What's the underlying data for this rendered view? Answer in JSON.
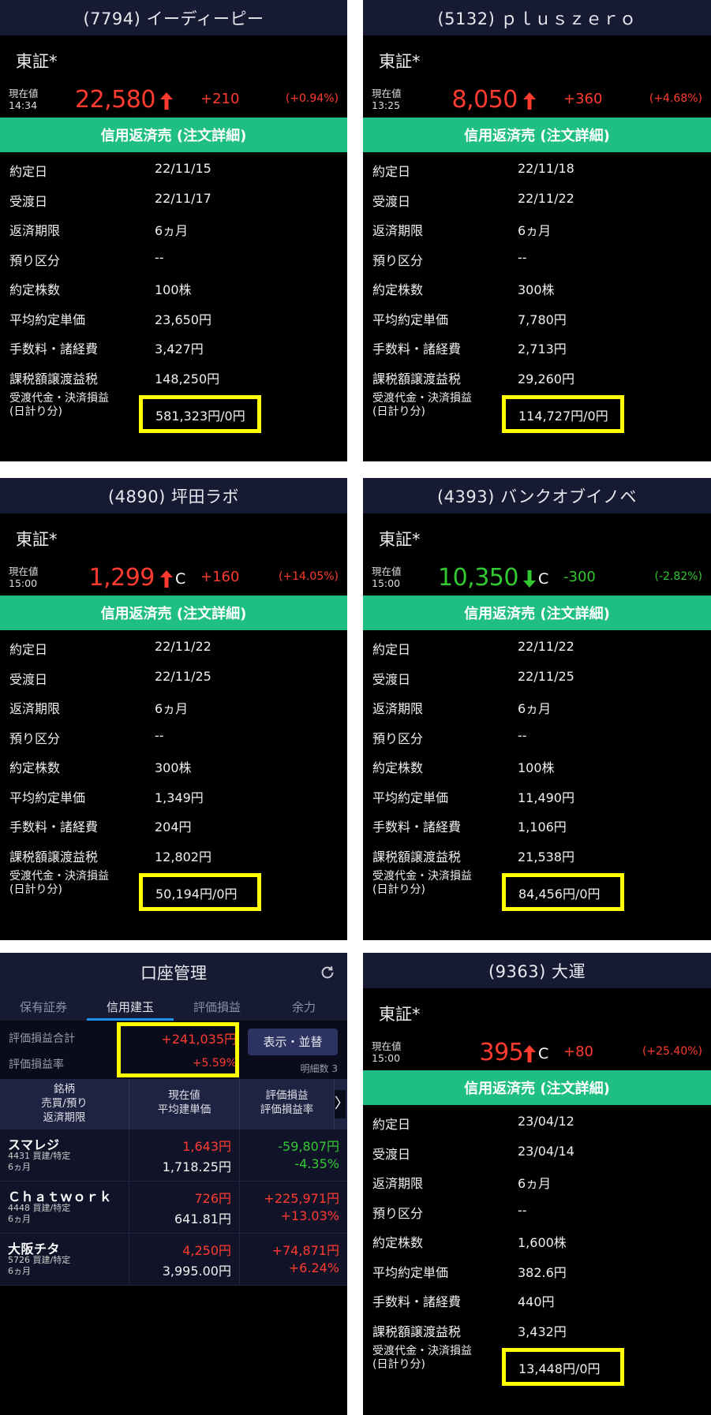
{
  "orders": [
    {
      "title": "(7794) イーディーピー",
      "market": "東証*",
      "price_label_1": "現在値",
      "price_time": "14:34",
      "price": "22,580",
      "direction": "up",
      "c_flag": "",
      "change": "+210",
      "change_pct": "(+0.94%)",
      "section": "信用返済売 (注文詳細)",
      "rows": [
        {
          "k": "約定日",
          "v": "22/11/15"
        },
        {
          "k": "受渡日",
          "v": "22/11/17"
        },
        {
          "k": "返済期限",
          "v": "6ヵ月"
        },
        {
          "k": "預り区分",
          "v": "--"
        },
        {
          "k": "約定株数",
          "v": "100株"
        },
        {
          "k": "平均約定単価",
          "v": "23,650円"
        },
        {
          "k": "手数料・諸経費",
          "v": "3,427円"
        },
        {
          "k": "課税額譲渡益税",
          "v": "148,250円"
        }
      ],
      "settle_label_1": "受渡代金・決済損益",
      "settle_label_2": "(日計り分)",
      "settle_value": "581,323円/0円"
    },
    {
      "title": "(5132) ｐｌｕｓｚｅｒｏ",
      "market": "東証*",
      "price_label_1": "現在値",
      "price_time": "13:25",
      "price": "8,050",
      "direction": "up",
      "c_flag": "",
      "change": "+360",
      "change_pct": "(+4.68%)",
      "section": "信用返済売 (注文詳細)",
      "rows": [
        {
          "k": "約定日",
          "v": "22/11/18"
        },
        {
          "k": "受渡日",
          "v": "22/11/22"
        },
        {
          "k": "返済期限",
          "v": "6ヵ月"
        },
        {
          "k": "預り区分",
          "v": "--"
        },
        {
          "k": "約定株数",
          "v": "300株"
        },
        {
          "k": "平均約定単価",
          "v": "7,780円"
        },
        {
          "k": "手数料・諸経費",
          "v": "2,713円"
        },
        {
          "k": "課税額譲渡益税",
          "v": "29,260円"
        }
      ],
      "settle_label_1": "受渡代金・決済損益",
      "settle_label_2": "(日計り分)",
      "settle_value": "114,727円/0円"
    },
    {
      "title": "(4890) 坪田ラボ",
      "market": "東証*",
      "price_label_1": "現在値",
      "price_time": "15:00",
      "price": "1,299",
      "direction": "up",
      "c_flag": "C",
      "change": "+160",
      "change_pct": "(+14.05%)",
      "section": "信用返済売 (注文詳細)",
      "rows": [
        {
          "k": "約定日",
          "v": "22/11/22"
        },
        {
          "k": "受渡日",
          "v": "22/11/25"
        },
        {
          "k": "返済期限",
          "v": "6ヵ月"
        },
        {
          "k": "預り区分",
          "v": "--"
        },
        {
          "k": "約定株数",
          "v": "300株"
        },
        {
          "k": "平均約定単価",
          "v": "1,349円"
        },
        {
          "k": "手数料・諸経費",
          "v": "204円"
        },
        {
          "k": "課税額譲渡益税",
          "v": "12,802円"
        }
      ],
      "settle_label_1": "受渡代金・決済損益",
      "settle_label_2": "(日計り分)",
      "settle_value": "50,194円/0円"
    },
    {
      "title": "(4393) バンクオブイノベ",
      "market": "東証*",
      "price_label_1": "現在値",
      "price_time": "15:00",
      "price": "10,350",
      "direction": "down",
      "c_flag": "C",
      "change": "-300",
      "change_pct": "(-2.82%)",
      "section": "信用返済売 (注文詳細)",
      "rows": [
        {
          "k": "約定日",
          "v": "22/11/22"
        },
        {
          "k": "受渡日",
          "v": "22/11/25"
        },
        {
          "k": "返済期限",
          "v": "6ヵ月"
        },
        {
          "k": "預り区分",
          "v": "--"
        },
        {
          "k": "約定株数",
          "v": "100株"
        },
        {
          "k": "平均約定単価",
          "v": "11,490円"
        },
        {
          "k": "手数料・諸経費",
          "v": "1,106円"
        },
        {
          "k": "課税額譲渡益税",
          "v": "21,538円"
        }
      ],
      "settle_label_1": "受渡代金・決済損益",
      "settle_label_2": "(日計り分)",
      "settle_value": "84,456円/0円"
    },
    {
      "title": "(9363) 大運",
      "market": "東証*",
      "price_label_1": "現在値",
      "price_time": "15:00",
      "price": "395",
      "direction": "up",
      "c_flag": "C",
      "change": "+80",
      "change_pct": "(+25.40%)",
      "section": "信用返済売 (注文詳細)",
      "rows": [
        {
          "k": "約定日",
          "v": "23/04/12"
        },
        {
          "k": "受渡日",
          "v": "23/04/14"
        },
        {
          "k": "返済期限",
          "v": "6ヵ月"
        },
        {
          "k": "預り区分",
          "v": "--"
        },
        {
          "k": "約定株数",
          "v": "1,600株"
        },
        {
          "k": "平均約定単価",
          "v": "382.6円"
        },
        {
          "k": "手数料・諸経費",
          "v": "440円"
        },
        {
          "k": "課税額譲渡益税",
          "v": "3,432円"
        }
      ],
      "settle_label_1": "受渡代金・決済損益",
      "settle_label_2": "(日計り分)",
      "settle_value": "13,448円/0円"
    }
  ],
  "account": {
    "title": "口座管理",
    "refresh_icon": "refresh-icon",
    "tabs": [
      "保有証券",
      "信用建玉",
      "評価損益",
      "余力"
    ],
    "active_tab": 1,
    "total_pl_label": "評価損益合計",
    "total_pl_value": "+241,035円",
    "pl_rate_label": "評価損益率",
    "pl_rate_value": "+5.59%",
    "display_button": "表示・並替",
    "detail_count": "明細数 3",
    "headers": {
      "col1": [
        "銘柄",
        "売買/預り",
        "返済期限"
      ],
      "col2": [
        "現在値",
        "平均建単価"
      ],
      "col3": [
        "評価損益",
        "評価損益率"
      ]
    },
    "scroll_glyph": "〉",
    "positions": [
      {
        "name": "スマレジ",
        "meta1": "4431 買建/特定",
        "meta2": "6ヵ月",
        "price": "1,643円",
        "avg": "1,718.25円",
        "pl": "-59,807円",
        "pl_rate": "-4.35%",
        "pl_color": "#32c832"
      },
      {
        "name": "Ｃｈａｔｗｏｒｋ",
        "meta1": "4448 買建/特定",
        "meta2": "6ヵ月",
        "price": "726円",
        "avg": "641.81円",
        "pl": "+225,971円",
        "pl_rate": "+13.03%",
        "pl_color": "#ff3b30"
      },
      {
        "name": "大阪チタ",
        "meta1": "5726 買建/特定",
        "meta2": "6ヵ月",
        "price": "4,250円",
        "avg": "3,995.00円",
        "pl": "+74,871円",
        "pl_rate": "+6.24%",
        "pl_color": "#ff3b30"
      }
    ]
  },
  "colors": {
    "up": "#ff3b30",
    "down": "#32c832",
    "highlight": "#ffff00",
    "section_green": "#1fbf83",
    "header_navy": "#161a33"
  }
}
